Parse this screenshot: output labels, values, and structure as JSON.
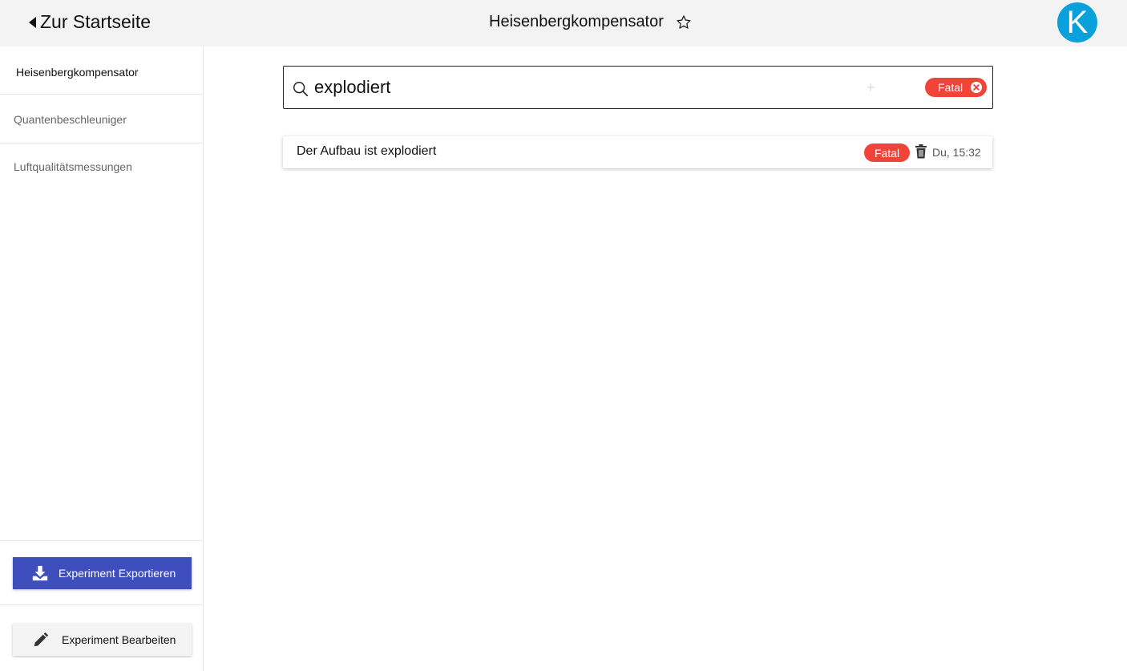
{
  "header": {
    "back_label": "Zur Startseite",
    "title": "Heisenbergkompensator",
    "avatar_letter": "K",
    "avatar_color": "#0aa0dc"
  },
  "sidebar": {
    "items": [
      {
        "label": "Heisenbergkompensator",
        "active": true
      },
      {
        "label": "Quantenbeschleuniger",
        "active": false
      },
      {
        "label": "Luftqualitätsmessungen",
        "active": false
      }
    ],
    "export_label": "Experiment Exportieren",
    "edit_label": "Experiment Bearbeiten",
    "export_color": "#3f4ebd"
  },
  "search": {
    "value": "explodiert",
    "filter_chip": "Fatal",
    "chip_color": "#f04438"
  },
  "results": [
    {
      "title": "Der Aufbau ist explodiert",
      "badge": "Fatal",
      "time": "Du, 15:32"
    }
  ]
}
